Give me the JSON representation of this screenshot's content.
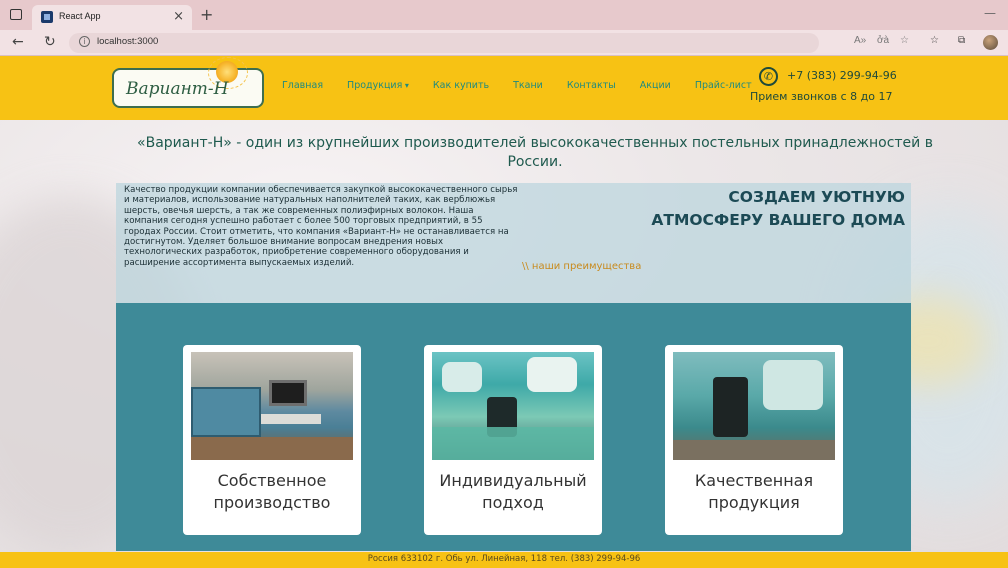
{
  "browser": {
    "tab_title": "React App",
    "tab_close": "×",
    "new_tab": "+",
    "url": "localhost:3000",
    "read_aloud": "Aᵃ",
    "translate": "☷"
  },
  "header": {
    "logo_text": "Вариант-Н",
    "nav": [
      {
        "label": "Главная"
      },
      {
        "label": "Продукция"
      },
      {
        "label": "Как купить"
      },
      {
        "label": "Ткани"
      },
      {
        "label": "Контакты"
      },
      {
        "label": "Акции"
      },
      {
        "label": "Прайс-лист"
      }
    ],
    "phone": "+7 (383) 299-94-96",
    "hours": "Прием звонков с 8 до 17"
  },
  "hero": {
    "title": "«Вариант-Н» - один из крупнейших производителей высококачественных постельных принадлежностей в России."
  },
  "about": {
    "text": "Качество продукции компании обеспечивается закупкой высококачественного сырья и материалов, использование натуральных наполнителей таких, как верблюжья шерсть, овечья шерсть, а так же современных полиэфирных волокон. Наша компания сегодня успешно работает с более 500 торговых предприятий, в 55 городах России. Стоит отметить, что компания «Вариант-Н» не останавливается на достигнутом. Уделяет большое внимание вопросам внедрения новых технологических разработок, приобретение современного оборудования и расширение ассортимента выпускаемых изделий.",
    "slogan_line1": "СОЗДАЕМ УЮТНУЮ",
    "slogan_line2": "АТМОСФЕРУ ВАШЕГО ДОМА",
    "advantages_link": "\\\\ наши преимущества"
  },
  "cards": [
    {
      "line1": "Собственное",
      "line2": "производство"
    },
    {
      "line1": "Индивидуальный",
      "line2": "подход"
    },
    {
      "line1": "Качественная",
      "line2": "продукция"
    }
  ],
  "footer": {
    "address": "Россия 633102 г. Обь ул. Линейная, 118 тел. (383) 299-94-96"
  },
  "colors": {
    "header_bg": "#f7c214",
    "nav_text": "#1f8a7f",
    "panel_teal": "#3e8a98",
    "accent_orange": "#c88a1d"
  }
}
